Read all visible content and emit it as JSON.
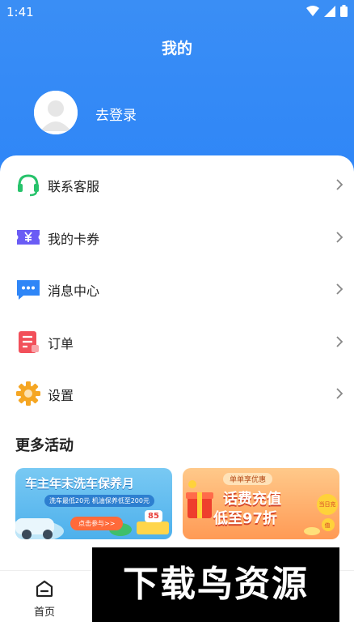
{
  "status_bar": {
    "time": "1:41"
  },
  "header": {
    "title": "我的"
  },
  "profile": {
    "login_label": "去登录"
  },
  "menu": [
    {
      "label": "联系客服",
      "icon": "headset-icon"
    },
    {
      "label": "我的卡券",
      "icon": "coupon-icon"
    },
    {
      "label": "消息中心",
      "icon": "message-icon"
    },
    {
      "label": "订单",
      "icon": "order-icon"
    },
    {
      "label": "设置",
      "icon": "gear-icon"
    }
  ],
  "activities": {
    "title": "更多活动",
    "banners": [
      {
        "title": "车主年末洗车保养月",
        "subtitle": "洗车最低20元 机油保养低至200元",
        "button": "点击参与>>",
        "badge": "85"
      },
      {
        "tag": "单单享优惠",
        "title_line1": "话费充值",
        "title_line2": "低至97折",
        "corner": "当日充值"
      }
    ]
  },
  "tabbar": {
    "home_label": "首页"
  },
  "watermark": "下载鸟资源",
  "colors": {
    "header_blue": "#3a8ef5",
    "headset_green": "#27c36b",
    "coupon_purple": "#6a5cf5",
    "message_blue": "#2f86f7",
    "order_red": "#f2505a",
    "gear_orange": "#f5a623"
  }
}
